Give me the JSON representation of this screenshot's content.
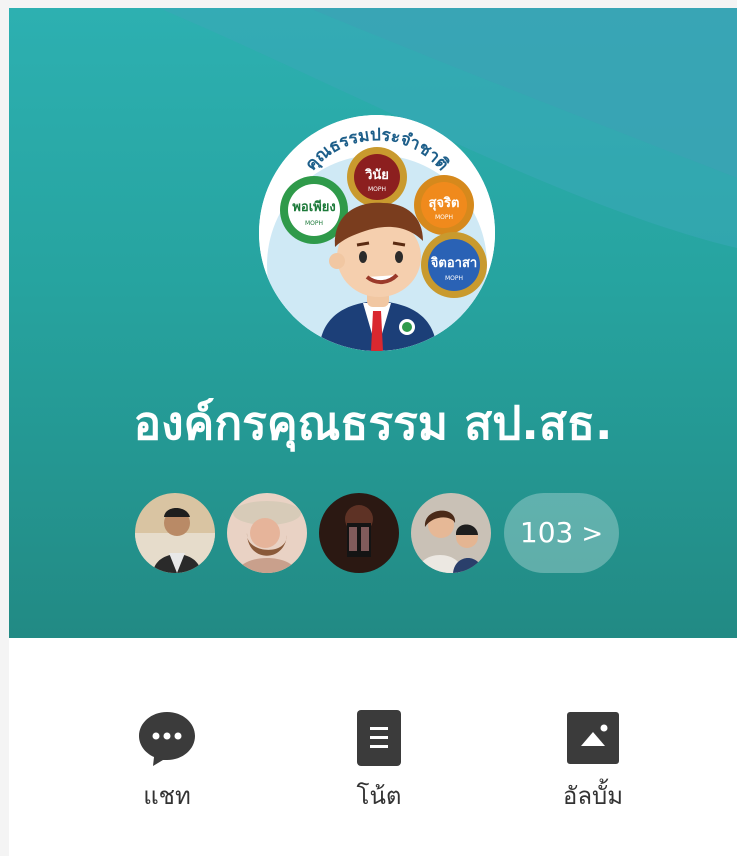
{
  "group": {
    "name": "องค์กรคุณธรรม สป.สธ.",
    "header_colors": {
      "top": "#2db0b1",
      "bottom": "#228a84"
    }
  },
  "logo": {
    "arc_text": "คุณธรรมประจำชาติ",
    "gear_labels": [
      "พอเพียง",
      "วินัย",
      "สุจริต",
      "จิตอาสา"
    ],
    "gear_sub_label": "MOPH"
  },
  "members": {
    "avatars": [
      {
        "icon": "member-avatar-1"
      },
      {
        "icon": "member-avatar-2"
      },
      {
        "icon": "member-avatar-3"
      },
      {
        "icon": "member-avatar-4"
      }
    ],
    "count_label": "103",
    "count_chevron": ">"
  },
  "actions": [
    {
      "label": "แชท",
      "icon": "chat-bubble-icon"
    },
    {
      "label": "โน้ต",
      "icon": "note-icon"
    },
    {
      "label": "อัลบั้ม",
      "icon": "album-icon"
    }
  ]
}
